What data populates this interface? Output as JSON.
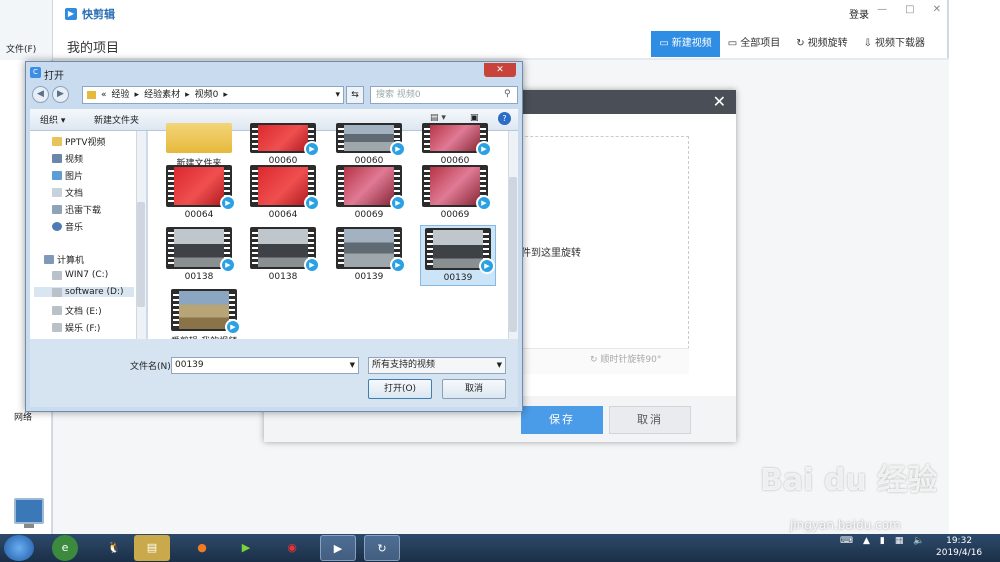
{
  "app": {
    "name": "快剪辑",
    "login": "登录",
    "header_title": "我的项目",
    "tabs": [
      {
        "label": "新建视频",
        "icon": "video-icon"
      },
      {
        "label": "全部项目",
        "icon": "folder-icon"
      },
      {
        "label": "视频旋转",
        "icon": "rotate-icon"
      },
      {
        "label": "视频下载器",
        "icon": "download-icon"
      }
    ],
    "accent": "#2f8de4"
  },
  "background_explorer": {
    "menu_file": "文件(F)",
    "organize": "组",
    "network": "网络"
  },
  "rotate_dialog": {
    "hint": "件到这里旋转",
    "rotate_left_suffix": "°",
    "rotate_right": "顺时针旋转90°",
    "save": "保存",
    "cancel": "取消"
  },
  "file_dialog": {
    "title": "打开",
    "breadcrumb": [
      "«",
      "经验",
      "经验素材",
      "视频0"
    ],
    "search_placeholder": "搜索 视频0",
    "toolbar": {
      "organize": "组织 ▾",
      "new_folder": "新建文件夹"
    },
    "tree": [
      {
        "label": "PPTV视频",
        "icon": "folder-icon"
      },
      {
        "label": "视频",
        "icon": "video-library-icon"
      },
      {
        "label": "图片",
        "icon": "pictures-icon"
      },
      {
        "label": "文档",
        "icon": "documents-icon"
      },
      {
        "label": "迅雷下载",
        "icon": "download-icon"
      },
      {
        "label": "音乐",
        "icon": "music-icon"
      },
      {
        "label": "计算机",
        "icon": "computer-icon"
      },
      {
        "label": "WIN7 (C:)",
        "icon": "drive-icon"
      },
      {
        "label": "software (D:)",
        "icon": "drive-icon"
      },
      {
        "label": "文档 (E:)",
        "icon": "drive-icon"
      },
      {
        "label": "娱乐 (F:)",
        "icon": "drive-icon"
      }
    ],
    "files": [
      {
        "label": "新建文件夹",
        "thumb": "folder"
      },
      {
        "label": "00060",
        "thumb": "red"
      },
      {
        "label": "00060",
        "thumb": "road"
      },
      {
        "label": "00060",
        "thumb": "pink"
      },
      {
        "label": "00064",
        "thumb": "red"
      },
      {
        "label": "00064",
        "thumb": "red"
      },
      {
        "label": "00069",
        "thumb": "pink"
      },
      {
        "label": "00069",
        "thumb": "pink"
      },
      {
        "label": "00138",
        "thumb": "car"
      },
      {
        "label": "00138",
        "thumb": "car"
      },
      {
        "label": "00139",
        "thumb": "road"
      },
      {
        "label": "00139",
        "thumb": "car",
        "selected": true
      },
      {
        "label": "爱剪辑-我的视频",
        "thumb": "desert"
      }
    ],
    "filename_label": "文件名(N):",
    "filename_value": "00139",
    "filetype": "所有支持的视频",
    "open": "打开(O)",
    "cancel": "取消"
  },
  "taskbar": {
    "clock_time": "19:32",
    "clock_date": "2019/4/16",
    "apps": [
      "ie-icon",
      "qq-icon",
      "explorer-icon",
      "firefox-icon",
      "iqiyi-icon",
      "record-icon",
      "kuaijianji-icon",
      "refresh-app-icon"
    ]
  },
  "watermark": {
    "text": "Bai du 经验",
    "sub": "jingyan.baidu.com"
  }
}
